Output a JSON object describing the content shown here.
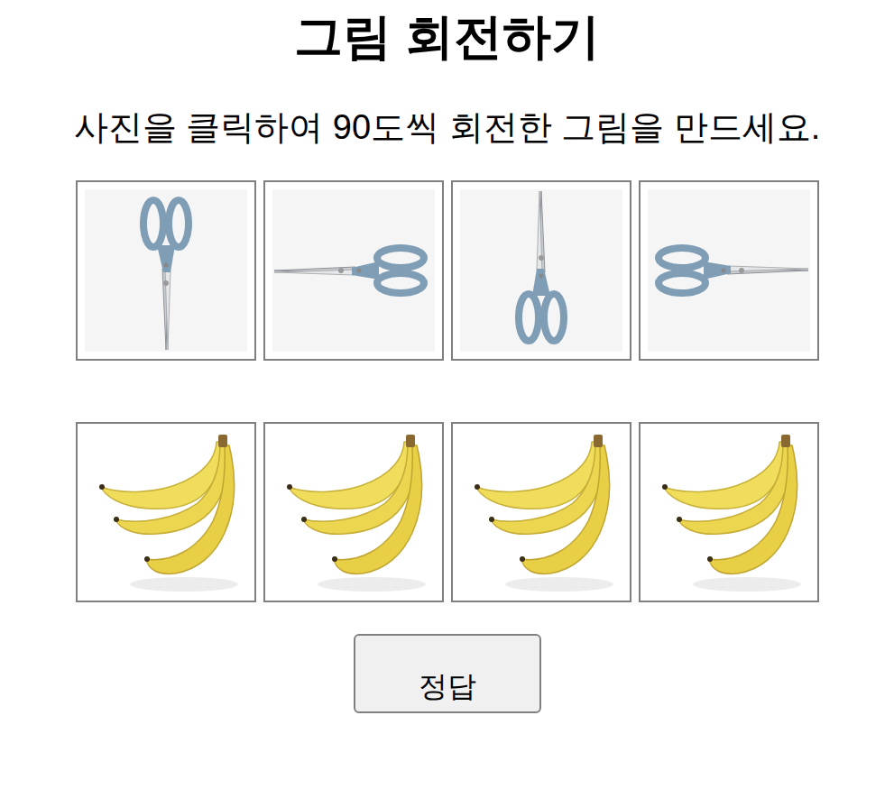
{
  "title": "그림 회전하기",
  "instruction": "사진을 클릭하여 90도씩 회전한 그림을 만드세요.",
  "rows": [
    {
      "kind": "scissors",
      "tiles": [
        {
          "rotation": 0
        },
        {
          "rotation": 90
        },
        {
          "rotation": 180
        },
        {
          "rotation": 270
        }
      ]
    },
    {
      "kind": "banana",
      "tiles": [
        {
          "rotation": 0
        },
        {
          "rotation": 0
        },
        {
          "rotation": 0
        },
        {
          "rotation": 0
        }
      ]
    }
  ],
  "answer_button": "정답"
}
